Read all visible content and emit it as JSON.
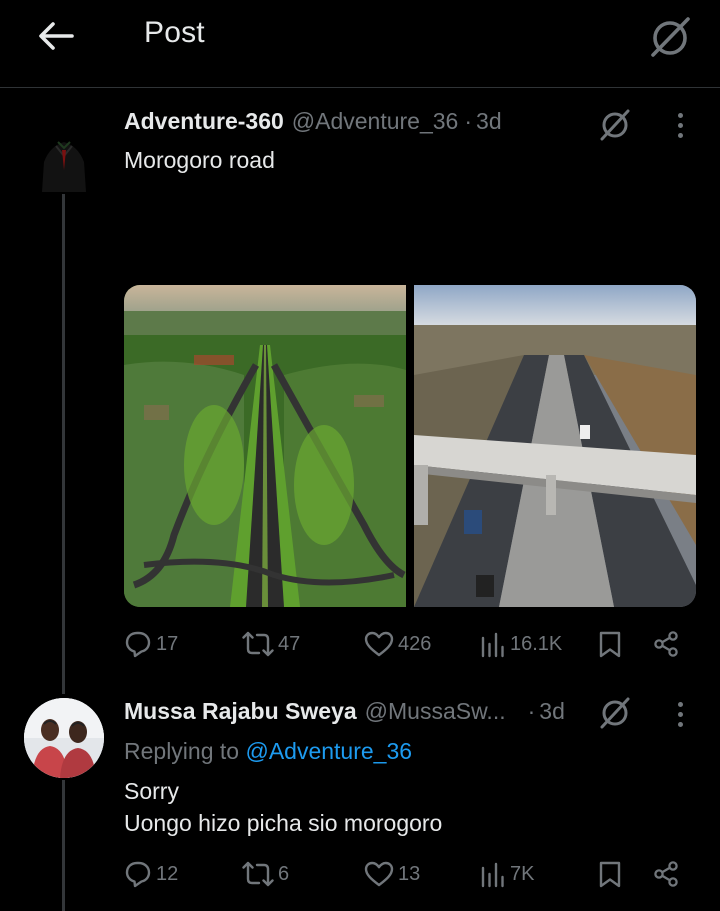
{
  "header": {
    "title": "Post",
    "back_icon": "arrow-left-icon",
    "grok_icon": "grok-icon"
  },
  "tweet": {
    "author_name": "Adventure-360",
    "author_handle": "@Adventure_36",
    "separator": "·",
    "time": "3d",
    "text": "Morogoro road",
    "stats": {
      "replies": "17",
      "reposts": "47",
      "likes": "426",
      "views": "16.1K"
    }
  },
  "reply": {
    "author_name": "Mussa Rajabu Sweya",
    "author_handle": "@MussaSw...",
    "separator": "·",
    "time": "3d",
    "replying_prefix": "Replying to ",
    "replying_to": "@Adventure_36",
    "line1": "Sorry",
    "line2": "Uongo hizo picha sio morogoro",
    "stats": {
      "replies": "12",
      "reposts": "6",
      "likes": "13",
      "views": "7K"
    }
  },
  "colors": {
    "background": "#000000",
    "text": "#e7e9ea",
    "muted": "#71767b",
    "link": "#1d9bf0",
    "divider": "#2f3336"
  }
}
